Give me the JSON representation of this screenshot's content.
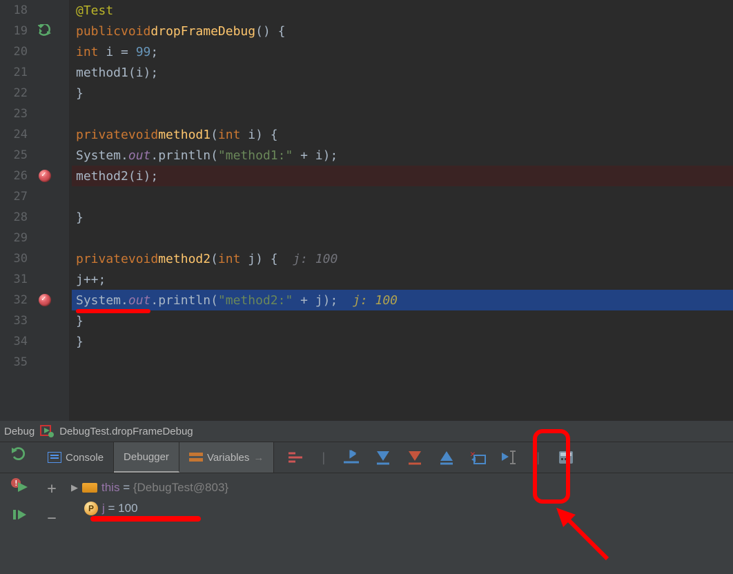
{
  "editor": {
    "lines": [
      {
        "num": 18
      },
      {
        "num": 19
      },
      {
        "num": 20
      },
      {
        "num": 21
      },
      {
        "num": 22
      },
      {
        "num": 23
      },
      {
        "num": 24
      },
      {
        "num": 25
      },
      {
        "num": 26
      },
      {
        "num": 27
      },
      {
        "num": 28
      },
      {
        "num": 29
      },
      {
        "num": 30
      },
      {
        "num": 31
      },
      {
        "num": 32
      },
      {
        "num": 33
      },
      {
        "num": 34
      },
      {
        "num": 35
      }
    ],
    "l18_annotation": "@Test",
    "l19_kw1": "public",
    "l19_kw2": "void",
    "l19_fn": "dropFrameDebug",
    "l19_tail": "() {",
    "l20_kw": "int",
    "l20_rest": " i = ",
    "l20_num": "99",
    "l20_semi": ";",
    "l21_call": "method1(i);",
    "l22_brace": "}",
    "l24_kw1": "private",
    "l24_kw2": "void",
    "l24_fn": "method1",
    "l24_open": "(",
    "l24_kw3": "int",
    "l24_rest": " i) {",
    "l25_sys": "System.",
    "l25_out": "out",
    "l25_mid": ".println(",
    "l25_str": "\"method1:\"",
    "l25_tail": " + i);",
    "l26_call": "method2(i);",
    "l28_brace": "}",
    "l30_kw1": "private",
    "l30_kw2": "void",
    "l30_fn": "method2",
    "l30_open": "(",
    "l30_kw3": "int",
    "l30_rest": " j) {  ",
    "l30_inline": "j: 100",
    "l31_stmt": "j++;",
    "l32_sys": "System.",
    "l32_out": "out",
    "l32_mid": ".println(",
    "l32_str": "\"method2:\"",
    "l32_tail": " + j);  ",
    "l32_inline": "j: 100",
    "l33_brace": "}",
    "l34_brace": "}"
  },
  "debug": {
    "title": "Debug",
    "run_config": "DebugTest.dropFrameDebug"
  },
  "tabs": {
    "console": "Console",
    "debugger": "Debugger",
    "variables": "Variables",
    "arrow": "→"
  },
  "variables": {
    "this_name": "this",
    "this_eq": " = ",
    "this_val": "{DebugTest@803}",
    "p_label": "P",
    "j_name": "j",
    "j_eq": " = ",
    "j_val": "100"
  },
  "toolbar_plus": "+",
  "toolbar_minus": "−"
}
